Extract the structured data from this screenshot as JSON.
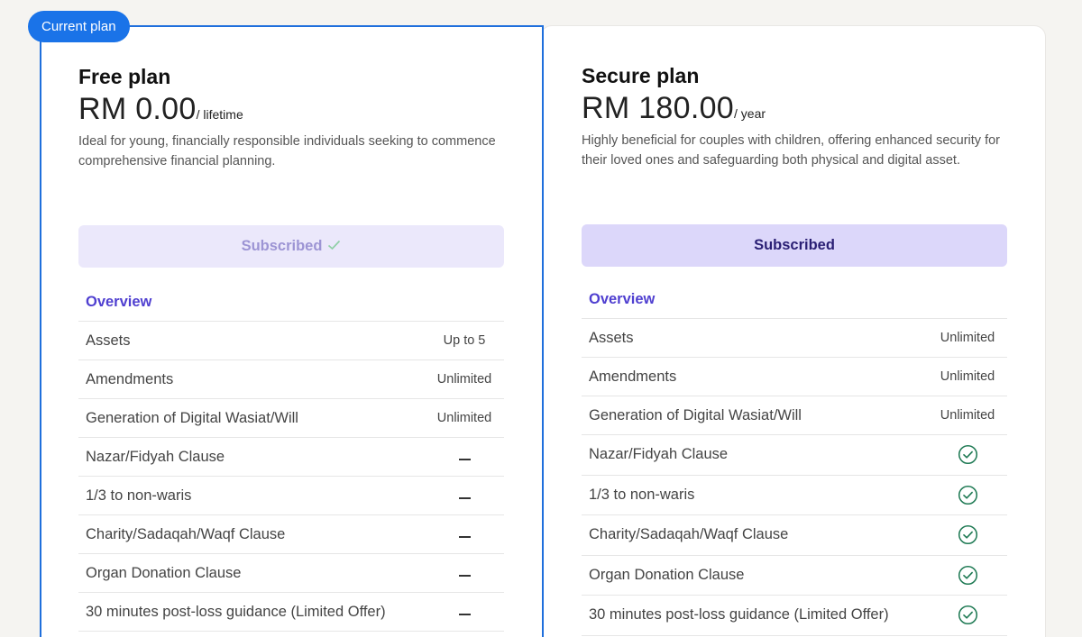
{
  "badge": {
    "label": "Current plan"
  },
  "colors": {
    "accent_blue": "#1a73e8",
    "overview_purple": "#4f3fd0",
    "check_green": "#1f7a54",
    "subscribed_bg": "#dcd7fa"
  },
  "plans": {
    "free": {
      "name": "Free plan",
      "price": "RM 0.00",
      "period": "/ lifetime",
      "description": "Ideal for young, financially responsible individuals seeking to commence comprehensive financial planning.",
      "button_label": "Subscribed",
      "button_icon": "check-icon",
      "overview_label": "Overview"
    },
    "secure": {
      "name": "Secure plan",
      "price": "RM 180.00",
      "period": "/ year",
      "description": "Highly beneficial for couples with children, offering enhanced security for their loved ones and safeguarding both physical and digital asset.",
      "button_label": "Subscribed",
      "overview_label": "Overview"
    }
  },
  "features": [
    {
      "label": "Assets",
      "free": "Up to 5",
      "secure": "Unlimited"
    },
    {
      "label": "Amendments",
      "free": "Unlimited",
      "secure": "Unlimited"
    },
    {
      "label": "Generation of Digital Wasiat/Will",
      "free": "Unlimited",
      "secure": "Unlimited"
    },
    {
      "label": "Nazar/Fidyah Clause",
      "free": "dash-icon",
      "secure": "check-circle-icon"
    },
    {
      "label": "1/3 to non-waris",
      "free": "dash-icon",
      "secure": "check-circle-icon"
    },
    {
      "label": "Charity/Sadaqah/Waqf Clause",
      "free": "dash-icon",
      "secure": "check-circle-icon"
    },
    {
      "label": "Organ Donation Clause",
      "free": "dash-icon",
      "secure": "check-circle-icon"
    },
    {
      "label": "30 minutes post-loss guidance (Limited Offer)",
      "free": "dash-icon",
      "secure": "check-circle-icon"
    }
  ]
}
